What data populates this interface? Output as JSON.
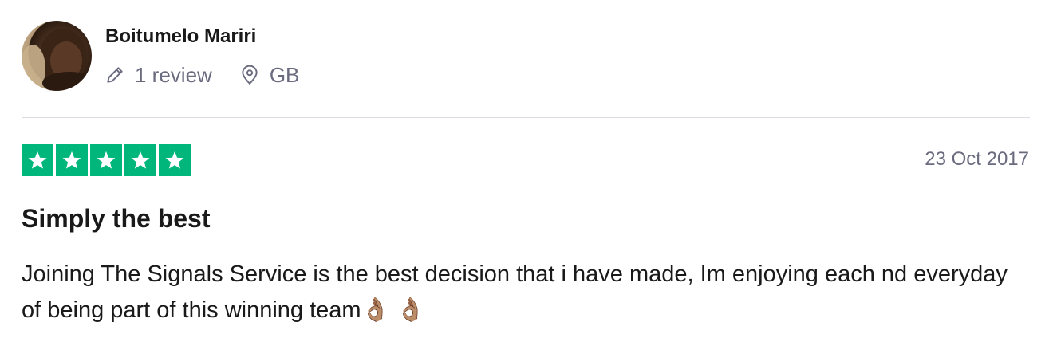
{
  "reviewer": {
    "name": "Boitumelo Mariri",
    "reviews": "1 review",
    "country": "GB"
  },
  "rating": {
    "stars": 5,
    "max": 5,
    "color": "#00b67a"
  },
  "review": {
    "date": "23 Oct 2017",
    "title": "Simply the best",
    "body": "Joining The Signals Service is the best decision that i have made, Im enjoying each nd everyday of being part of this winning team👌🏽 👌🏽"
  },
  "icons": {
    "reviews": "pencil-icon",
    "country": "location-pin-icon",
    "star": "star-icon"
  }
}
